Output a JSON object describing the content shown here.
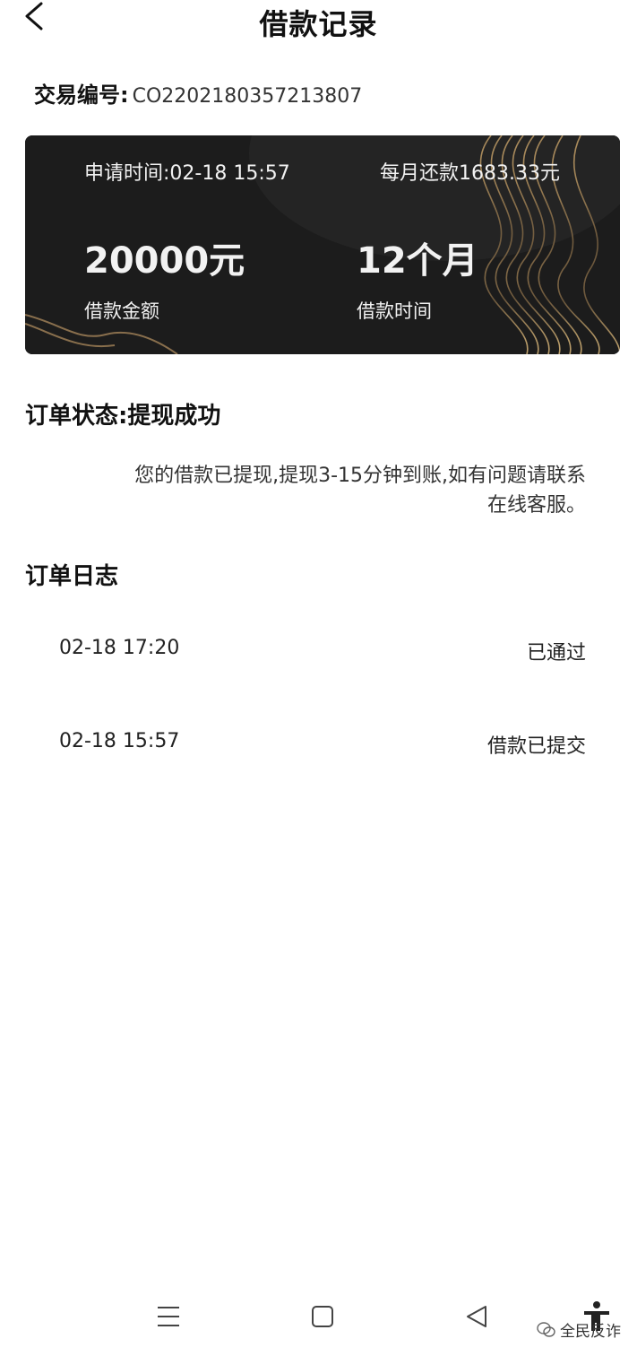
{
  "header": {
    "title": "借款记录"
  },
  "transaction": {
    "label": "交易编号:",
    "id": "CO2202180357213807"
  },
  "card": {
    "apply_time": "申请时间:02-18 15:57",
    "monthly_repayment": "每月还款1683.33元",
    "amount": "20000元",
    "amount_label": "借款金额",
    "term": "12个月",
    "term_label": "借款时间"
  },
  "status": {
    "text": "订单状态:提现成功"
  },
  "notice": {
    "line1": "您的借款已提现,提现3-15分钟到账,如有问题请联系",
    "line2": "在线客服。"
  },
  "log": {
    "title": "订单日志",
    "entries": [
      {
        "time": "02-18 17:20",
        "status": "已通过"
      },
      {
        "time": "02-18 15:57",
        "status": "借款已提交"
      }
    ]
  },
  "watermark": {
    "text": "全民反诈"
  },
  "icons": {
    "back": "chevron-left-icon",
    "nav_menu": "menu-icon",
    "nav_home": "square-icon",
    "nav_back": "triangle-back-icon",
    "accessibility": "accessibility-icon"
  }
}
